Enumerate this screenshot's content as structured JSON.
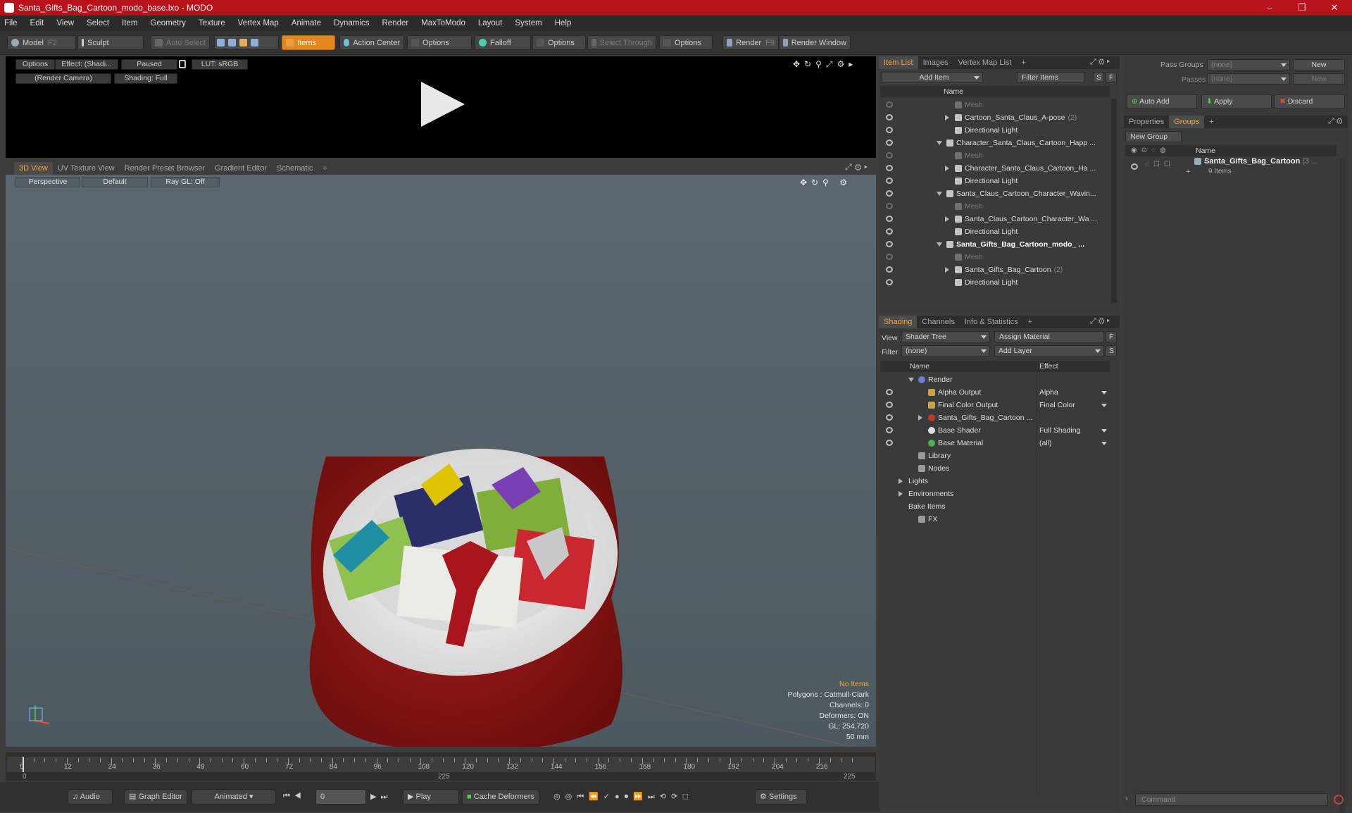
{
  "window": {
    "title": "Santa_Gifts_Bag_Cartoon_modo_base.lxo - MODO",
    "min": "–",
    "max": "❐",
    "close": "✕"
  },
  "menu": [
    "File",
    "Edit",
    "View",
    "Select",
    "Item",
    "Geometry",
    "Texture",
    "Vertex Map",
    "Animate",
    "Dynamics",
    "Render",
    "MaxToModo",
    "Layout",
    "System",
    "Help"
  ],
  "toolbar": {
    "model": "Model",
    "model_key": "F2",
    "sculpt": "Sculpt",
    "auto_select": "Auto Select",
    "items": "Items",
    "action_center": "Action Center",
    "options1": "Options",
    "falloff": "Falloff",
    "options2": "Options",
    "select_through": "Select Through",
    "options3": "Options",
    "render": "Render",
    "render_key": "F9",
    "render_window": "Render Window"
  },
  "render_preview": {
    "options": "Options",
    "effect": "Effect: (Shadi...",
    "paused": "Paused",
    "lut": "LUT: sRGB",
    "camera": "(Render Camera)",
    "shading": "Shading: Full"
  },
  "view_tabs": [
    "3D View",
    "UV Texture View",
    "Render Preset Browser",
    "Gradient Editor",
    "Schematic",
    "+"
  ],
  "viewport": {
    "perspective": "Perspective",
    "default": "Default",
    "raygl": "Ray GL: Off",
    "stats": [
      "No Items",
      "Polygons : Catmull-Clark",
      "Channels: 0",
      "Deformers: ON",
      "GL: 254,720",
      "50 mm"
    ]
  },
  "timeline": {
    "labels": [
      "0",
      "12",
      "24",
      "36",
      "48",
      "60",
      "72",
      "84",
      "96",
      "108",
      "120",
      "132",
      "144",
      "156",
      "168",
      "180",
      "192",
      "204",
      "216"
    ],
    "start": "0",
    "mid": "225",
    "end": "225"
  },
  "bottom": {
    "audio": "Audio",
    "graph_editor": "Graph Editor",
    "animated": "Animated",
    "frame": "0",
    "play": "Play",
    "cache": "Cache Deformers",
    "settings": "Settings"
  },
  "item_list": {
    "tabs": [
      "Item List",
      "Images",
      "Vertex Map List",
      "+"
    ],
    "add_item": "Add Item",
    "filter": "Filter Items",
    "s": "S",
    "f": "F",
    "col_name": "Name",
    "rows": [
      {
        "label": "Mesh",
        "indent": 3,
        "dim": true,
        "tri": ""
      },
      {
        "label": "Cartoon_Santa_Claus_A-pose",
        "cnt": "(2)",
        "indent": 3,
        "dim": false,
        "tri": "right"
      },
      {
        "label": "Directional Light",
        "indent": 3,
        "dim": false,
        "tri": ""
      },
      {
        "label": "Character_Santa_Claus_Cartoon_Happ ...",
        "indent": 2,
        "dim": false,
        "tri": "down"
      },
      {
        "label": "Mesh",
        "indent": 3,
        "dim": true,
        "tri": ""
      },
      {
        "label": "Character_Santa_Claus_Cartoon_Ha ...",
        "indent": 3,
        "dim": false,
        "tri": "right"
      },
      {
        "label": "Directional Light",
        "indent": 3,
        "dim": false,
        "tri": ""
      },
      {
        "label": "Santa_Claus_Cartoon_Character_Wavin...",
        "indent": 2,
        "dim": false,
        "tri": "down"
      },
      {
        "label": "Mesh",
        "indent": 3,
        "dim": true,
        "tri": ""
      },
      {
        "label": "Santa_Claus_Cartoon_Character_Wa ...",
        "indent": 3,
        "dim": false,
        "tri": "right"
      },
      {
        "label": "Directional Light",
        "indent": 3,
        "dim": false,
        "tri": ""
      },
      {
        "label": "Santa_Gifts_Bag_Cartoon_modo_ ...",
        "indent": 2,
        "dim": false,
        "tri": "down",
        "bold": true
      },
      {
        "label": "Mesh",
        "indent": 3,
        "dim": true,
        "tri": ""
      },
      {
        "label": "Santa_Gifts_Bag_Cartoon",
        "cnt": "(2)",
        "indent": 3,
        "dim": false,
        "tri": "right"
      },
      {
        "label": "Directional Light",
        "indent": 3,
        "dim": false,
        "tri": ""
      }
    ]
  },
  "shading": {
    "tabs": [
      "Shading",
      "Channels",
      "Info & Statistics",
      "+"
    ],
    "view_label": "View",
    "view_value": "Shader Tree",
    "assign": "Assign Material",
    "filter_label": "Filter",
    "filter_value": "(none)",
    "add_layer": "Add Layer",
    "col_name": "Name",
    "col_effect": "Effect",
    "rows": [
      {
        "label": "Render",
        "effect": "",
        "indent": 1,
        "tri": "down",
        "eye": false,
        "icon": "#6a7fd0"
      },
      {
        "label": "Alpha Output",
        "effect": "Alpha",
        "indent": 2,
        "tri": "",
        "eye": true,
        "icon": "#c9a24a"
      },
      {
        "label": "Final Color Output",
        "effect": "Final Color",
        "indent": 2,
        "tri": "",
        "eye": true,
        "icon": "#c9a24a"
      },
      {
        "label": "Santa_Gifts_Bag_Cartoon ...",
        "effect": "",
        "indent": 2,
        "tri": "right",
        "eye": true,
        "icon": "#c0392b"
      },
      {
        "label": "Base Shader",
        "effect": "Full Shading",
        "indent": 2,
        "tri": "",
        "eye": true,
        "icon": "#dddddd"
      },
      {
        "label": "Base Material",
        "effect": "(all)",
        "indent": 2,
        "tri": "",
        "eye": true,
        "icon": "#4caf50"
      },
      {
        "label": "Library",
        "effect": "",
        "indent": 1,
        "tri": "",
        "eye": false,
        "icon": "#9a9a9a"
      },
      {
        "label": "Nodes",
        "effect": "",
        "indent": 1,
        "tri": "",
        "eye": false,
        "icon": "#9a9a9a"
      },
      {
        "label": "Lights",
        "effect": "",
        "indent": 0,
        "tri": "right",
        "eye": false,
        "icon": ""
      },
      {
        "label": "Environments",
        "effect": "",
        "indent": 0,
        "tri": "right",
        "eye": false,
        "icon": ""
      },
      {
        "label": "Bake Items",
        "effect": "",
        "indent": 0,
        "tri": "",
        "eye": false,
        "icon": ""
      },
      {
        "label": "FX",
        "effect": "",
        "indent": 1,
        "tri": "",
        "eye": false,
        "icon": "#9a9a9a"
      }
    ]
  },
  "groups": {
    "pass_groups": "Pass Groups",
    "pass_value": "(none)",
    "new1": "New",
    "passes": "Passes",
    "passes_value": "(none)",
    "new2": "New",
    "auto_add": "Auto Add",
    "apply": "Apply",
    "discard": "Discard",
    "tabs": [
      "Properties",
      "Groups",
      "+"
    ],
    "new_group": "New Group",
    "col_name": "Name",
    "group_name": "Santa_Gifts_Bag_Cartoon",
    "group_cnt": "(3 ...",
    "group_items": "9 Items"
  },
  "command": {
    "placeholder": "Command"
  }
}
